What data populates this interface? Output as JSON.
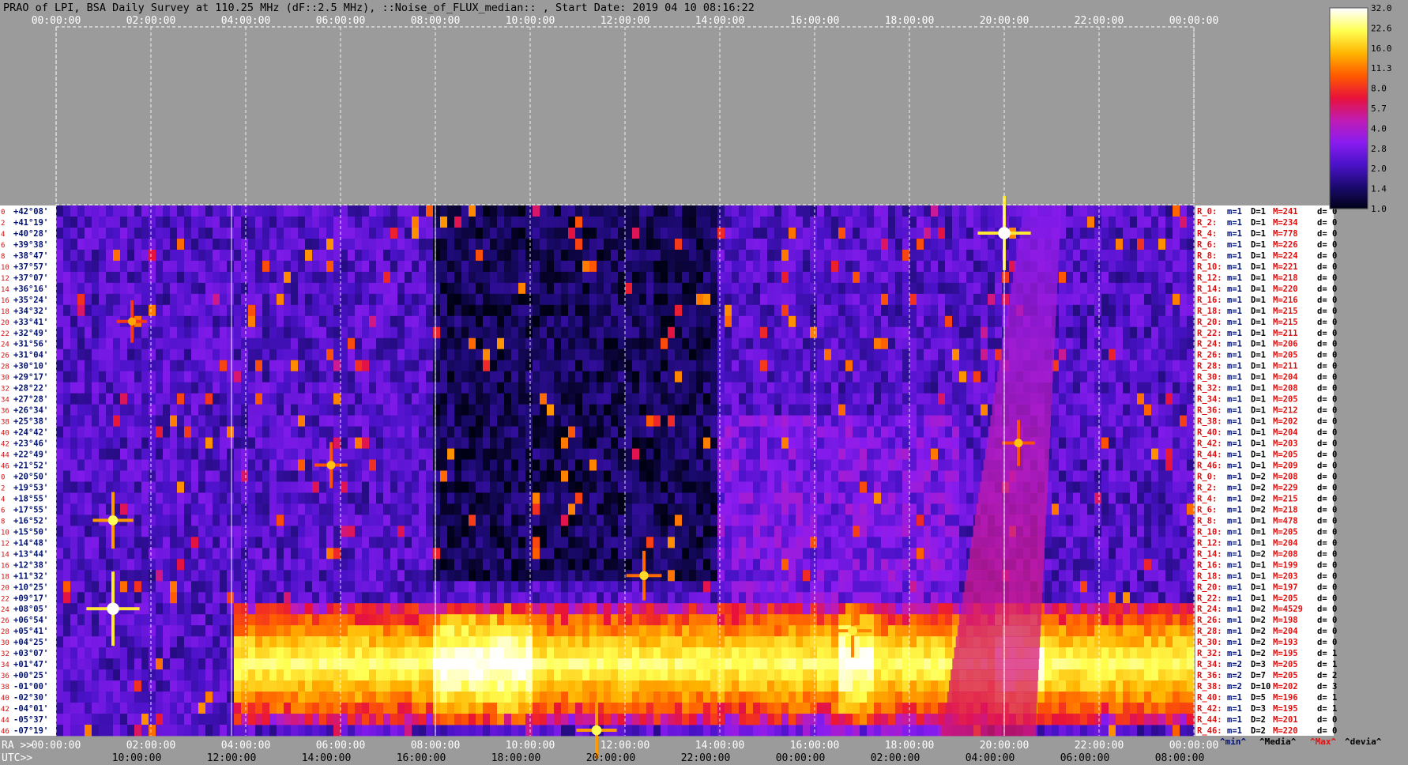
{
  "chart_data": {
    "type": "heatmap",
    "title": "PRAO of LPI, BSA Daily Survey at 110.25 MHz (dF::2.5 MHz), ::Noise_of_FLUX_median:: , Start Date: 2019 04 10 08:16:22",
    "x_top_ticks": [
      "00:00:00",
      "02:00:00",
      "04:00:00",
      "06:00:00",
      "08:00:00",
      "10:00:00",
      "12:00:00",
      "14:00:00",
      "16:00:00",
      "18:00:00",
      "20:00:00",
      "22:00:00",
      "00:00:00"
    ],
    "ra_axis_label": "RA >>",
    "ra_ticks": [
      "00:00:00",
      "02:00:00",
      "04:00:00",
      "06:00:00",
      "08:00:00",
      "10:00:00",
      "12:00:00",
      "14:00:00",
      "16:00:00",
      "18:00:00",
      "20:00:00",
      "22:00:00",
      "00:00:00"
    ],
    "utc_axis_label": "UTC>>",
    "utc_ticks": [
      "10:00:00",
      "12:00:00",
      "14:00:00",
      "16:00:00",
      "18:00:00",
      "20:00:00",
      "22:00:00",
      "00:00:00",
      "02:00:00",
      "04:00:00",
      "06:00:00",
      "08:00:00"
    ],
    "declinations": [
      "+42°08'",
      "+41°19'",
      "+40°28'",
      "+39°38'",
      "+38°47'",
      "+37°57'",
      "+37°07'",
      "+36°16'",
      "+35°24'",
      "+34°32'",
      "+33°41'",
      "+32°49'",
      "+31°56'",
      "+31°04'",
      "+30°10'",
      "+29°17'",
      "+28°22'",
      "+27°28'",
      "+26°34'",
      "+25°38'",
      "+24°42'",
      "+23°46'",
      "+22°49'",
      "+21°52'",
      "+20°50'",
      "+19°53'",
      "+18°55'",
      "+17°55'",
      "+16°52'",
      "+15°50'",
      "+14°48'",
      "+13°44'",
      "+12°38'",
      "+11°32'",
      "+10°25'",
      "+09°17'",
      "+08°05'",
      "+06°54'",
      "+05°41'",
      "+04°25'",
      "+03°07'",
      "+01°47'",
      "+00°25'",
      "-01°00'",
      "-02°30'",
      "-04°01'",
      "-05°37'",
      "-07°19'"
    ],
    "row_numbers": [
      "0",
      "2",
      "4",
      "6",
      "8",
      "10",
      "12",
      "14",
      "16",
      "18",
      "20",
      "22",
      "24",
      "26",
      "28",
      "30",
      "32",
      "34",
      "36",
      "38",
      "40",
      "42",
      "44",
      "46",
      "0",
      "2",
      "4",
      "6",
      "8",
      "10",
      "12",
      "14",
      "16",
      "18",
      "20",
      "22",
      "24",
      "26",
      "28",
      "30",
      "32",
      "34",
      "36",
      "38",
      "40",
      "42",
      "44",
      "46"
    ],
    "row_stats": [
      {
        "r": "R_0:",
        "m": "m=1",
        "D": "D=1",
        "M": "M=241",
        "d": "d= 0"
      },
      {
        "r": "R_2:",
        "m": "m=1",
        "D": "D=1",
        "M": "M=234",
        "d": "d= 0"
      },
      {
        "r": "R_4:",
        "m": "m=1",
        "D": "D=1",
        "M": "M=778",
        "d": "d= 0"
      },
      {
        "r": "R_6:",
        "m": "m=1",
        "D": "D=1",
        "M": "M=226",
        "d": "d= 0"
      },
      {
        "r": "R_8:",
        "m": "m=1",
        "D": "D=1",
        "M": "M=224",
        "d": "d= 0"
      },
      {
        "r": "R_10:",
        "m": "m=1",
        "D": "D=1",
        "M": "M=221",
        "d": "d= 0"
      },
      {
        "r": "R_12:",
        "m": "m=1",
        "D": "D=1",
        "M": "M=218",
        "d": "d= 0"
      },
      {
        "r": "R_14:",
        "m": "m=1",
        "D": "D=1",
        "M": "M=220",
        "d": "d= 0"
      },
      {
        "r": "R_16:",
        "m": "m=1",
        "D": "D=1",
        "M": "M=216",
        "d": "d= 0"
      },
      {
        "r": "R_18:",
        "m": "m=1",
        "D": "D=1",
        "M": "M=215",
        "d": "d= 0"
      },
      {
        "r": "R_20:",
        "m": "m=1",
        "D": "D=1",
        "M": "M=215",
        "d": "d= 0"
      },
      {
        "r": "R_22:",
        "m": "m=1",
        "D": "D=1",
        "M": "M=211",
        "d": "d= 0"
      },
      {
        "r": "R_24:",
        "m": "m=1",
        "D": "D=1",
        "M": "M=206",
        "d": "d= 0"
      },
      {
        "r": "R_26:",
        "m": "m=1",
        "D": "D=1",
        "M": "M=205",
        "d": "d= 0"
      },
      {
        "r": "R_28:",
        "m": "m=1",
        "D": "D=1",
        "M": "M=211",
        "d": "d= 0"
      },
      {
        "r": "R_30:",
        "m": "m=1",
        "D": "D=1",
        "M": "M=204",
        "d": "d= 0"
      },
      {
        "r": "R_32:",
        "m": "m=1",
        "D": "D=1",
        "M": "M=208",
        "d": "d= 0"
      },
      {
        "r": "R_34:",
        "m": "m=1",
        "D": "D=1",
        "M": "M=205",
        "d": "d= 0"
      },
      {
        "r": "R_36:",
        "m": "m=1",
        "D": "D=1",
        "M": "M=212",
        "d": "d= 0"
      },
      {
        "r": "R_38:",
        "m": "m=1",
        "D": "D=1",
        "M": "M=202",
        "d": "d= 0"
      },
      {
        "r": "R_40:",
        "m": "m=1",
        "D": "D=1",
        "M": "M=204",
        "d": "d= 0"
      },
      {
        "r": "R_42:",
        "m": "m=1",
        "D": "D=1",
        "M": "M=203",
        "d": "d= 0"
      },
      {
        "r": "R_44:",
        "m": "m=1",
        "D": "D=1",
        "M": "M=205",
        "d": "d= 0"
      },
      {
        "r": "R_46:",
        "m": "m=1",
        "D": "D=1",
        "M": "M=209",
        "d": "d= 0"
      },
      {
        "r": "R_0:",
        "m": "m=1",
        "D": "D=2",
        "M": "M=208",
        "d": "d= 0"
      },
      {
        "r": "R_2:",
        "m": "m=1",
        "D": "D=2",
        "M": "M=229",
        "d": "d= 0"
      },
      {
        "r": "R_4:",
        "m": "m=1",
        "D": "D=2",
        "M": "M=215",
        "d": "d= 0"
      },
      {
        "r": "R_6:",
        "m": "m=1",
        "D": "D=2",
        "M": "M=218",
        "d": "d= 0"
      },
      {
        "r": "R_8:",
        "m": "m=1",
        "D": "D=1",
        "M": "M=478",
        "d": "d= 0"
      },
      {
        "r": "R_10:",
        "m": "m=1",
        "D": "D=1",
        "M": "M=205",
        "d": "d= 0"
      },
      {
        "r": "R_12:",
        "m": "m=1",
        "D": "D=1",
        "M": "M=204",
        "d": "d= 0"
      },
      {
        "r": "R_14:",
        "m": "m=1",
        "D": "D=2",
        "M": "M=208",
        "d": "d= 0"
      },
      {
        "r": "R_16:",
        "m": "m=1",
        "D": "D=1",
        "M": "M=199",
        "d": "d= 0"
      },
      {
        "r": "R_18:",
        "m": "m=1",
        "D": "D=1",
        "M": "M=203",
        "d": "d= 0"
      },
      {
        "r": "R_20:",
        "m": "m=1",
        "D": "D=1",
        "M": "M=197",
        "d": "d= 0"
      },
      {
        "r": "R_22:",
        "m": "m=1",
        "D": "D=1",
        "M": "M=205",
        "d": "d= 0"
      },
      {
        "r": "R_24:",
        "m": "m=1",
        "D": "D=2",
        "M": "M=4529",
        "d": "d= 0"
      },
      {
        "r": "R_26:",
        "m": "m=1",
        "D": "D=2",
        "M": "M=198",
        "d": "d= 0"
      },
      {
        "r": "R_28:",
        "m": "m=1",
        "D": "D=2",
        "M": "M=204",
        "d": "d= 0"
      },
      {
        "r": "R_30:",
        "m": "m=1",
        "D": "D=2",
        "M": "M=193",
        "d": "d= 0"
      },
      {
        "r": "R_32:",
        "m": "m=1",
        "D": "D=2",
        "M": "M=195",
        "d": "d= 1"
      },
      {
        "r": "R_34:",
        "m": "m=2",
        "D": "D=3",
        "M": "M=205",
        "d": "d= 1"
      },
      {
        "r": "R_36:",
        "m": "m=2",
        "D": "D=7",
        "M": "M=205",
        "d": "d= 2"
      },
      {
        "r": "R_38:",
        "m": "m=2",
        "D": "D=10",
        "M": "M=202",
        "d": "d= 3"
      },
      {
        "r": "R_40:",
        "m": "m=1",
        "D": "D=5",
        "M": "M=196",
        "d": "d= 1"
      },
      {
        "r": "R_42:",
        "m": "m=1",
        "D": "D=3",
        "M": "M=195",
        "d": "d= 1"
      },
      {
        "r": "R_44:",
        "m": "m=1",
        "D": "D=2",
        "M": "M=201",
        "d": "d= 0"
      },
      {
        "r": "R_46:",
        "m": "m=1",
        "D": "D=2",
        "M": "M=220",
        "d": "d= 0"
      }
    ],
    "stats_legend": [
      "^min^",
      "^Media^",
      "^Max^",
      "^devia^"
    ],
    "colorbar_ticks": [
      "32.0",
      "22.6",
      "16.0",
      "11.3",
      "8.0",
      "5.7",
      "4.0",
      "2.8",
      "2.0",
      "1.4",
      "1.0"
    ],
    "colorbar_range": [
      1.0,
      32.0
    ],
    "colorscale": [
      "#000014",
      "#1a0a6e",
      "#4a12c8",
      "#8a1cf0",
      "#c01cb4",
      "#e8123a",
      "#ff5a00",
      "#ffb400",
      "#ffff50",
      "#ffffff"
    ],
    "features": {
      "equatorial_band_rows": [
        36,
        46
      ],
      "bright_sources": [
        {
          "ra_h": 1.2,
          "row": 36,
          "intensity": 32
        },
        {
          "ra_h": 1.2,
          "row": 28,
          "intensity": 22
        },
        {
          "ra_h": 1.6,
          "row": 10,
          "intensity": 14
        },
        {
          "ra_h": 5.8,
          "row": 23,
          "intensity": 16
        },
        {
          "ra_h": 12.4,
          "row": 33,
          "intensity": 18
        },
        {
          "ra_h": 11.4,
          "row": 47,
          "intensity": 22
        },
        {
          "ra_h": 20.0,
          "row": 2,
          "intensity": 32
        },
        {
          "ra_h": 20.3,
          "row": 21,
          "intensity": 16
        },
        {
          "ra_h": 16.8,
          "row": 38,
          "intensity": 20
        }
      ],
      "galactic_plane_ra_h": [
        18.5,
        20.8
      ]
    }
  }
}
